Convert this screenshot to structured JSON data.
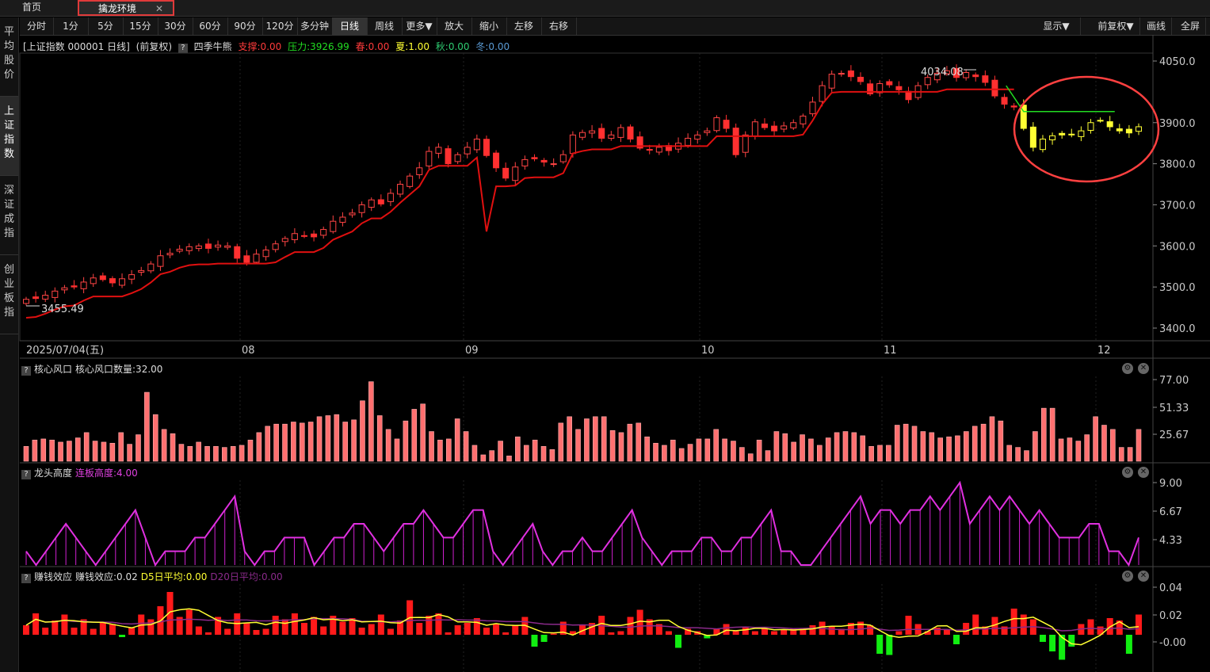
{
  "tabs": {
    "home": "首页",
    "active": "擒龙环境",
    "close_icon": "close-icon"
  },
  "toolbar": {
    "periods": [
      "分时",
      "1分",
      "5分",
      "15分",
      "30分",
      "60分",
      "90分",
      "120分",
      "多分钟",
      "日线",
      "周线",
      "更多▼",
      "放大",
      "缩小",
      "左移",
      "右移"
    ],
    "selected": "日线",
    "right": [
      "显示▼",
      "前复权▼",
      "画线",
      "全屏"
    ]
  },
  "sidebar": [
    {
      "label": "平均股价"
    },
    {
      "label": "上证指数",
      "selected": true
    },
    {
      "label": "深证成指"
    },
    {
      "label": "创业板指"
    }
  ],
  "main_info": {
    "title": "[上证指数 000001 日线]",
    "adjust": "(前复权)",
    "indicator": "四季牛熊",
    "support": "支撑:0.00",
    "pressure": "压力:3926.99",
    "spring": "春:0.00",
    "summer": "夏:1.00",
    "autumn": "秋:0.00",
    "winter": "冬:0.00",
    "colors": {
      "support": "#ff3b3b",
      "pressure": "#22dd22",
      "spring": "#ff3b3b",
      "summer": "#ffff33",
      "autumn": "#2ecc71",
      "winter": "#5b9bd5"
    }
  },
  "price_axis": [
    "4050.0",
    "3900.0",
    "3800.0",
    "3700.0",
    "3600.0",
    "3500.0",
    "3400.0"
  ],
  "time_axis": {
    "start": "2025/07/04(五)",
    "months": [
      "08",
      "09",
      "10",
      "11",
      "12"
    ]
  },
  "annotations": {
    "high": "4034.08",
    "low": "3455.49"
  },
  "panels": [
    {
      "title": "核心风口",
      "value": "核心风口数量:32.00",
      "axis": [
        "77.00",
        "51.33",
        "25.67"
      ]
    },
    {
      "title": "龙头高度",
      "value": "连板高度:4.00",
      "axis": [
        "9.00",
        "6.67",
        "4.33"
      ]
    },
    {
      "title": "赚钱效应",
      "value": "赚钱效应:0.02",
      "d5": "D5日平均:0.00",
      "d20": "D20日平均:0.00",
      "axis": [
        "0.04",
        "0.02",
        "-0.00"
      ]
    }
  ],
  "chart_data": [
    {
      "type": "candlestick",
      "title": "上证指数 000001 日线",
      "ohlc_close": [
        3470,
        3472,
        3480,
        3490,
        3498,
        3500,
        3512,
        3522,
        3518,
        3510,
        3520,
        3530,
        3540,
        3556,
        3576,
        3582,
        3592,
        3598,
        3600,
        3594,
        3602,
        3600,
        3570,
        3560,
        3580,
        3590,
        3605,
        3618,
        3630,
        3625,
        3622,
        3640,
        3660,
        3670,
        3680,
        3700,
        3712,
        3702,
        3728,
        3750,
        3770,
        3790,
        3830,
        3840,
        3800,
        3822,
        3840,
        3860,
        3820,
        3790,
        3765,
        3792,
        3810,
        3812,
        3804,
        3800,
        3822,
        3870,
        3876,
        3880,
        3862,
        3870,
        3888,
        3860,
        3838,
        3833,
        3840,
        3832,
        3850,
        3862,
        3870,
        3880,
        3912,
        3886,
        3822,
        3870,
        3902,
        3888,
        3880,
        3892,
        3900,
        3916,
        3950,
        3990,
        4018,
        4020,
        4012,
        4000,
        3970,
        3995,
        3992,
        3980,
        3956,
        3990,
        4010,
        4020,
        4026,
        4010,
        4022,
        4012,
        3998,
        3965,
        3945,
        3938,
        3886,
        3840,
        3860,
        3868,
        3870,
        3872,
        3880,
        3900,
        3905,
        3890,
        3880,
        3875,
        3890
      ]
    },
    {
      "type": "bar",
      "title": "核心风口",
      "values": [
        14,
        20,
        21,
        20,
        18,
        19,
        22,
        27,
        19,
        18,
        17,
        27,
        16,
        25,
        65,
        44,
        30,
        26,
        16,
        14,
        18,
        14,
        14,
        13,
        14,
        15,
        20,
        27,
        33,
        35,
        35,
        37,
        36,
        37,
        42,
        43,
        44,
        37,
        39,
        57,
        75,
        43,
        30,
        21,
        38,
        49,
        54,
        28,
        20,
        21,
        40,
        28,
        15,
        6,
        10,
        19,
        5,
        23,
        15,
        20,
        14,
        11,
        36,
        42,
        30,
        40,
        42,
        42,
        29,
        27,
        35,
        36,
        23,
        17,
        15,
        20,
        12,
        16,
        21,
        21,
        30,
        21,
        19,
        13,
        7,
        20,
        10,
        28,
        26,
        18,
        25,
        21,
        15,
        22,
        27,
        28,
        27,
        24,
        14,
        15,
        15,
        34,
        35,
        33,
        28,
        27,
        22,
        23,
        24,
        28,
        33,
        35,
        42,
        38,
        15,
        13,
        10,
        28,
        50,
        50,
        21,
        22,
        19,
        25,
        42,
        34,
        30,
        13,
        13,
        30
      ]
    },
    {
      "type": "line",
      "title": "龙头高度",
      "values": [
        4,
        3,
        4,
        5,
        6,
        5,
        4,
        3,
        4,
        5,
        6,
        7,
        5,
        3,
        4,
        4,
        4,
        5,
        5,
        6,
        7,
        8,
        4,
        3,
        4,
        4,
        5,
        5,
        5,
        3,
        4,
        5,
        5,
        6,
        6,
        5,
        4,
        5,
        6,
        6,
        7,
        6,
        5,
        5,
        6,
        7,
        7,
        4,
        3,
        4,
        5,
        6,
        4,
        3,
        4,
        4,
        5,
        4,
        4,
        5,
        6,
        7,
        5,
        4,
        3,
        4,
        4,
        4,
        5,
        5,
        4,
        4,
        5,
        5,
        6,
        7,
        4,
        4,
        3,
        3,
        4,
        5,
        6,
        7,
        8,
        6,
        7,
        7,
        6,
        7,
        7,
        8,
        7,
        8,
        9,
        6,
        7,
        8,
        7,
        8,
        7,
        6,
        7,
        6,
        5,
        5,
        5,
        6,
        6,
        4,
        4,
        3,
        5
      ]
    },
    {
      "type": "bar",
      "title": "赚钱效应",
      "series": [
        {
          "name": "赚钱效应",
          "values": [
            0.008,
            0.018,
            0.006,
            0.012,
            0.017,
            0.006,
            0.013,
            0.005,
            0.011,
            0.009,
            -0.002,
            0.006,
            0.017,
            0.013,
            0.024,
            0.036,
            0.015,
            0.021,
            0.007,
            0.002,
            0.015,
            0.005,
            0.018,
            0.01,
            0.004,
            0.005,
            0.016,
            0.013,
            0.018,
            0.01,
            0.015,
            0.007,
            0.016,
            0.011,
            0.014,
            0.006,
            0.009,
            0.017,
            0.005,
            0.012,
            0.029,
            0.01,
            0.016,
            0.018,
            0.002,
            0.008,
            0.01,
            0.014,
            0.006,
            0.009,
            0.002,
            0.008,
            0.015,
            -0.01,
            -0.006,
            0.001,
            0.011,
            0.003,
            0.008,
            0.01,
            0.016,
            0.002,
            0.003,
            0.015,
            0.021,
            0.013,
            0.009,
            0.003,
            -0.011,
            0.005,
            0.003,
            -0.003,
            0.005,
            0.009,
            0.003,
            0.007,
            0.003,
            0.005,
            0.003,
            0.004,
            0.005,
            0.005,
            0.008,
            0.011,
            0.007,
            0.005,
            0.01,
            0.011,
            0.008,
            -0.016,
            -0.017,
            0.003,
            0.016,
            0.009,
            0.003,
            0.006,
            0.004,
            -0.008,
            0.01,
            0.017,
            0.007,
            0.015,
            0.007,
            0.022,
            0.017,
            0.013,
            -0.006,
            -0.014,
            -0.021,
            -0.01,
            0.009,
            0.013,
            0.007,
            0.014,
            0.012,
            -0.016,
            0.017
          ]
        }
      ],
      "d5": 0.0,
      "d20": 0.0
    }
  ]
}
